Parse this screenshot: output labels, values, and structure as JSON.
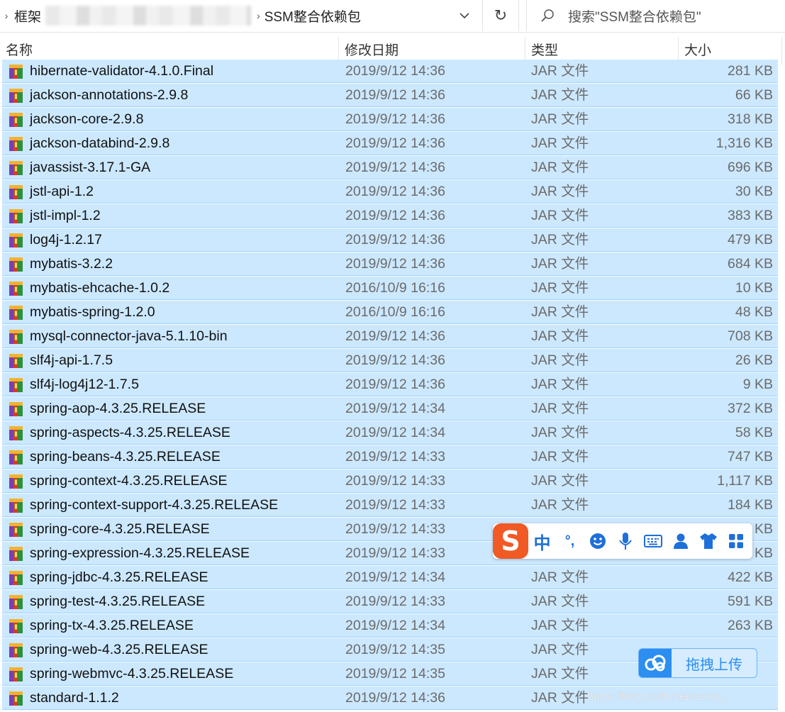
{
  "address": {
    "crumb_root": "框架",
    "current": "SSM整合依赖包"
  },
  "search": {
    "placeholder": "搜索\"SSM整合依赖包\""
  },
  "columns": {
    "name": "名称",
    "date": "修改日期",
    "type": "类型",
    "size": "大小"
  },
  "files": [
    {
      "name": "hibernate-validator-4.1.0.Final",
      "date": "2019/9/12 14:36",
      "type": "JAR 文件",
      "size": "281 KB"
    },
    {
      "name": "jackson-annotations-2.9.8",
      "date": "2019/9/12 14:36",
      "type": "JAR 文件",
      "size": "66 KB"
    },
    {
      "name": "jackson-core-2.9.8",
      "date": "2019/9/12 14:36",
      "type": "JAR 文件",
      "size": "318 KB"
    },
    {
      "name": "jackson-databind-2.9.8",
      "date": "2019/9/12 14:36",
      "type": "JAR 文件",
      "size": "1,316 KB"
    },
    {
      "name": "javassist-3.17.1-GA",
      "date": "2019/9/12 14:36",
      "type": "JAR 文件",
      "size": "696 KB"
    },
    {
      "name": "jstl-api-1.2",
      "date": "2019/9/12 14:36",
      "type": "JAR 文件",
      "size": "30 KB"
    },
    {
      "name": "jstl-impl-1.2",
      "date": "2019/9/12 14:36",
      "type": "JAR 文件",
      "size": "383 KB"
    },
    {
      "name": "log4j-1.2.17",
      "date": "2019/9/12 14:36",
      "type": "JAR 文件",
      "size": "479 KB"
    },
    {
      "name": "mybatis-3.2.2",
      "date": "2019/9/12 14:36",
      "type": "JAR 文件",
      "size": "684 KB"
    },
    {
      "name": "mybatis-ehcache-1.0.2",
      "date": "2016/10/9 16:16",
      "type": "JAR 文件",
      "size": "10 KB"
    },
    {
      "name": "mybatis-spring-1.2.0",
      "date": "2016/10/9 16:16",
      "type": "JAR 文件",
      "size": "48 KB"
    },
    {
      "name": "mysql-connector-java-5.1.10-bin",
      "date": "2019/9/12 14:36",
      "type": "JAR 文件",
      "size": "708 KB"
    },
    {
      "name": "slf4j-api-1.7.5",
      "date": "2019/9/12 14:36",
      "type": "JAR 文件",
      "size": "26 KB"
    },
    {
      "name": "slf4j-log4j12-1.7.5",
      "date": "2019/9/12 14:36",
      "type": "JAR 文件",
      "size": "9 KB"
    },
    {
      "name": "spring-aop-4.3.25.RELEASE",
      "date": "2019/9/12 14:34",
      "type": "JAR 文件",
      "size": "372 KB"
    },
    {
      "name": "spring-aspects-4.3.25.RELEASE",
      "date": "2019/9/12 14:34",
      "type": "JAR 文件",
      "size": "58 KB"
    },
    {
      "name": "spring-beans-4.3.25.RELEASE",
      "date": "2019/9/12 14:33",
      "type": "JAR 文件",
      "size": "747 KB"
    },
    {
      "name": "spring-context-4.3.25.RELEASE",
      "date": "2019/9/12 14:33",
      "type": "JAR 文件",
      "size": "1,117 KB"
    },
    {
      "name": "spring-context-support-4.3.25.RELEASE",
      "date": "2019/9/12 14:33",
      "type": "JAR 文件",
      "size": "184 KB"
    },
    {
      "name": "spring-core-4.3.25.RELEASE",
      "date": "2019/9/12 14:33",
      "type": "",
      "size": "KB"
    },
    {
      "name": "spring-expression-4.3.25.RELEASE",
      "date": "2019/9/12 14:33",
      "type": "",
      "size": "KB"
    },
    {
      "name": "spring-jdbc-4.3.25.RELEASE",
      "date": "2019/9/12 14:34",
      "type": "JAR 文件",
      "size": "422 KB"
    },
    {
      "name": "spring-test-4.3.25.RELEASE",
      "date": "2019/9/12 14:33",
      "type": "JAR 文件",
      "size": "591 KB"
    },
    {
      "name": "spring-tx-4.3.25.RELEASE",
      "date": "2019/9/12 14:34",
      "type": "JAR 文件",
      "size": "263 KB"
    },
    {
      "name": "spring-web-4.3.25.RELEASE",
      "date": "2019/9/12 14:35",
      "type": "JAR 文件",
      "size": ""
    },
    {
      "name": "spring-webmvc-4.3.25.RELEASE",
      "date": "2019/9/12 14:35",
      "type": "JAR 文件",
      "size": ""
    },
    {
      "name": "standard-1.1.2",
      "date": "2019/9/12 14:36",
      "type": "JAR 文件",
      "size": ""
    }
  ],
  "ime": {
    "mode_label": "中",
    "punct_label": "°,"
  },
  "upload": {
    "label": "拖拽上传"
  },
  "watermark": "https://blog.csdn.net/weixin_"
}
